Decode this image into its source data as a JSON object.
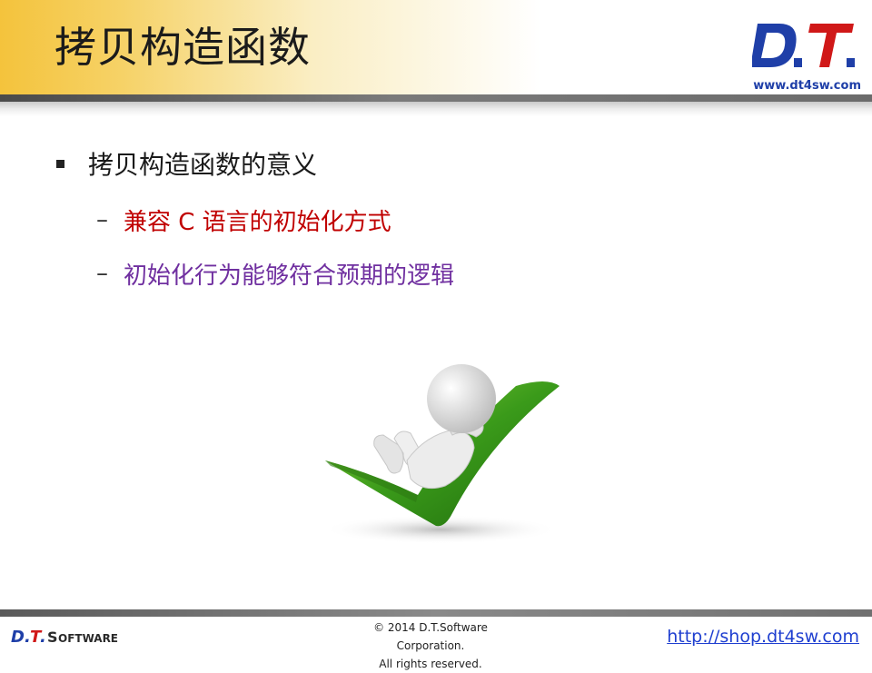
{
  "header": {
    "title": "拷贝构造函数",
    "logo_text": "D.T.",
    "logo_url": "www.dt4sw.com"
  },
  "content": {
    "bullet": "拷贝构造函数的意义",
    "sub_items": [
      {
        "text": "兼容 C 语言的初始化方式",
        "color": "#c00000"
      },
      {
        "text": "初始化行为能够符合预期的逻辑",
        "color": "#7030a0"
      }
    ],
    "illustration": "person-reclining-on-green-checkmark"
  },
  "footer": {
    "brand": "D.T.SOFTWARE",
    "copyright_line1": "© 2014 D.T.Software Corporation.",
    "copyright_line2": "All rights reserved.",
    "link": "http://shop.dt4sw.com"
  },
  "colors": {
    "header_gold": "#f4c33c",
    "logo_blue": "#1f3fa8",
    "logo_red": "#d01818",
    "check_green": "#3a9a1a"
  }
}
